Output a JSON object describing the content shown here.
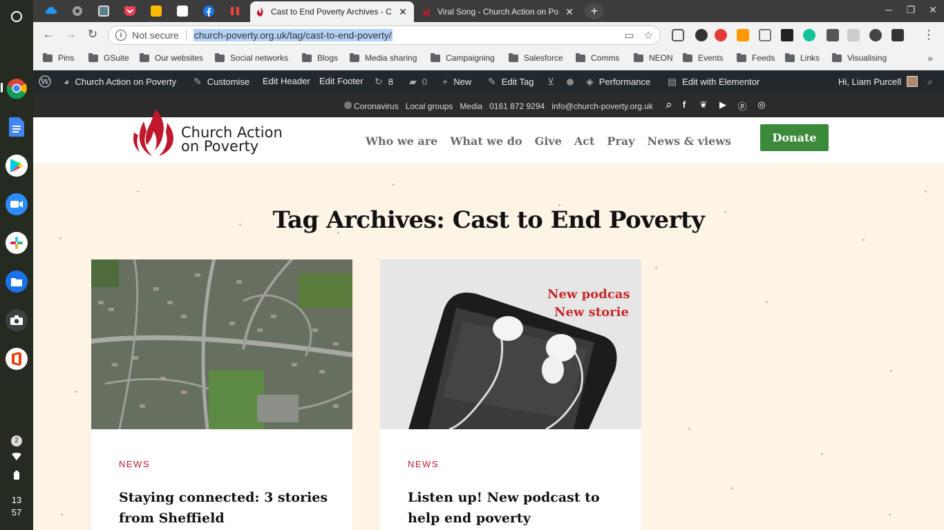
{
  "shelf": {
    "apps": [
      "chrome-icon",
      "docs-icon",
      "play-store-icon",
      "zoom-icon",
      "slack-icon",
      "files-icon",
      "camera-icon",
      "office-icon"
    ],
    "status": {
      "notifications": "2",
      "time_hour": "13",
      "time_min": "57"
    }
  },
  "tabs": {
    "pinned": [
      "tab-pinned-1",
      "tab-pinned-2",
      "tab-pinned-3",
      "tab-pinned-pocket",
      "tab-pinned-keep",
      "tab-pinned-5",
      "tab-pinned-facebook",
      "tab-pinned-7"
    ],
    "active_title": "Cast to End Poverty Archives - C",
    "inactive_title": "Viral Song - Church Action on Po"
  },
  "toolbar": {
    "security_label": "Not secure",
    "url": "church-poverty.org.uk/tag/cast-to-end-poverty/"
  },
  "bookmarks": [
    "Pins",
    "GSuite",
    "Our websites",
    "Social networks",
    "Blogs",
    "Media sharing",
    "Campaigning",
    "Salesforce",
    "Comms",
    "NEON",
    "Events",
    "Feeds",
    "Links",
    "Visualising"
  ],
  "wpadmin": {
    "site_name": "Church Action on Poverty",
    "customise": "Customise",
    "edit_header": "Edit Header",
    "edit_footer": "Edit Footer",
    "updates_count": "8",
    "comments_count": "0",
    "new": "New",
    "edit_tag": "Edit Tag",
    "performance": "Performance",
    "elementor": "Edit with Elementor",
    "greeting": "Hi, Liam Purcell"
  },
  "sitetop": {
    "coronavirus": "Coronavirus",
    "local_groups": "Local groups",
    "media": "Media",
    "phone": "0161 872 9294",
    "email": "info@church-poverty.org.uk"
  },
  "header": {
    "brand_line1": "Church Action",
    "brand_line2": "on Poverty",
    "nav": [
      "Who we are",
      "What we do",
      "Give",
      "Act",
      "Pray",
      "News & views"
    ],
    "donate": "Donate"
  },
  "page": {
    "title": "Tag Archives: Cast to End Poverty"
  },
  "cards": [
    {
      "category": "NEWS",
      "title": "Staying connected: 3 stories from Sheffield"
    },
    {
      "category": "NEWS",
      "title": "Listen up! New podcast to help end poverty",
      "image_text_1": "New podcas",
      "image_text_2": "New storie"
    }
  ],
  "colors": {
    "accent": "#c0172d",
    "donate": "#3a8a3a",
    "adminbar": "#23282d"
  }
}
